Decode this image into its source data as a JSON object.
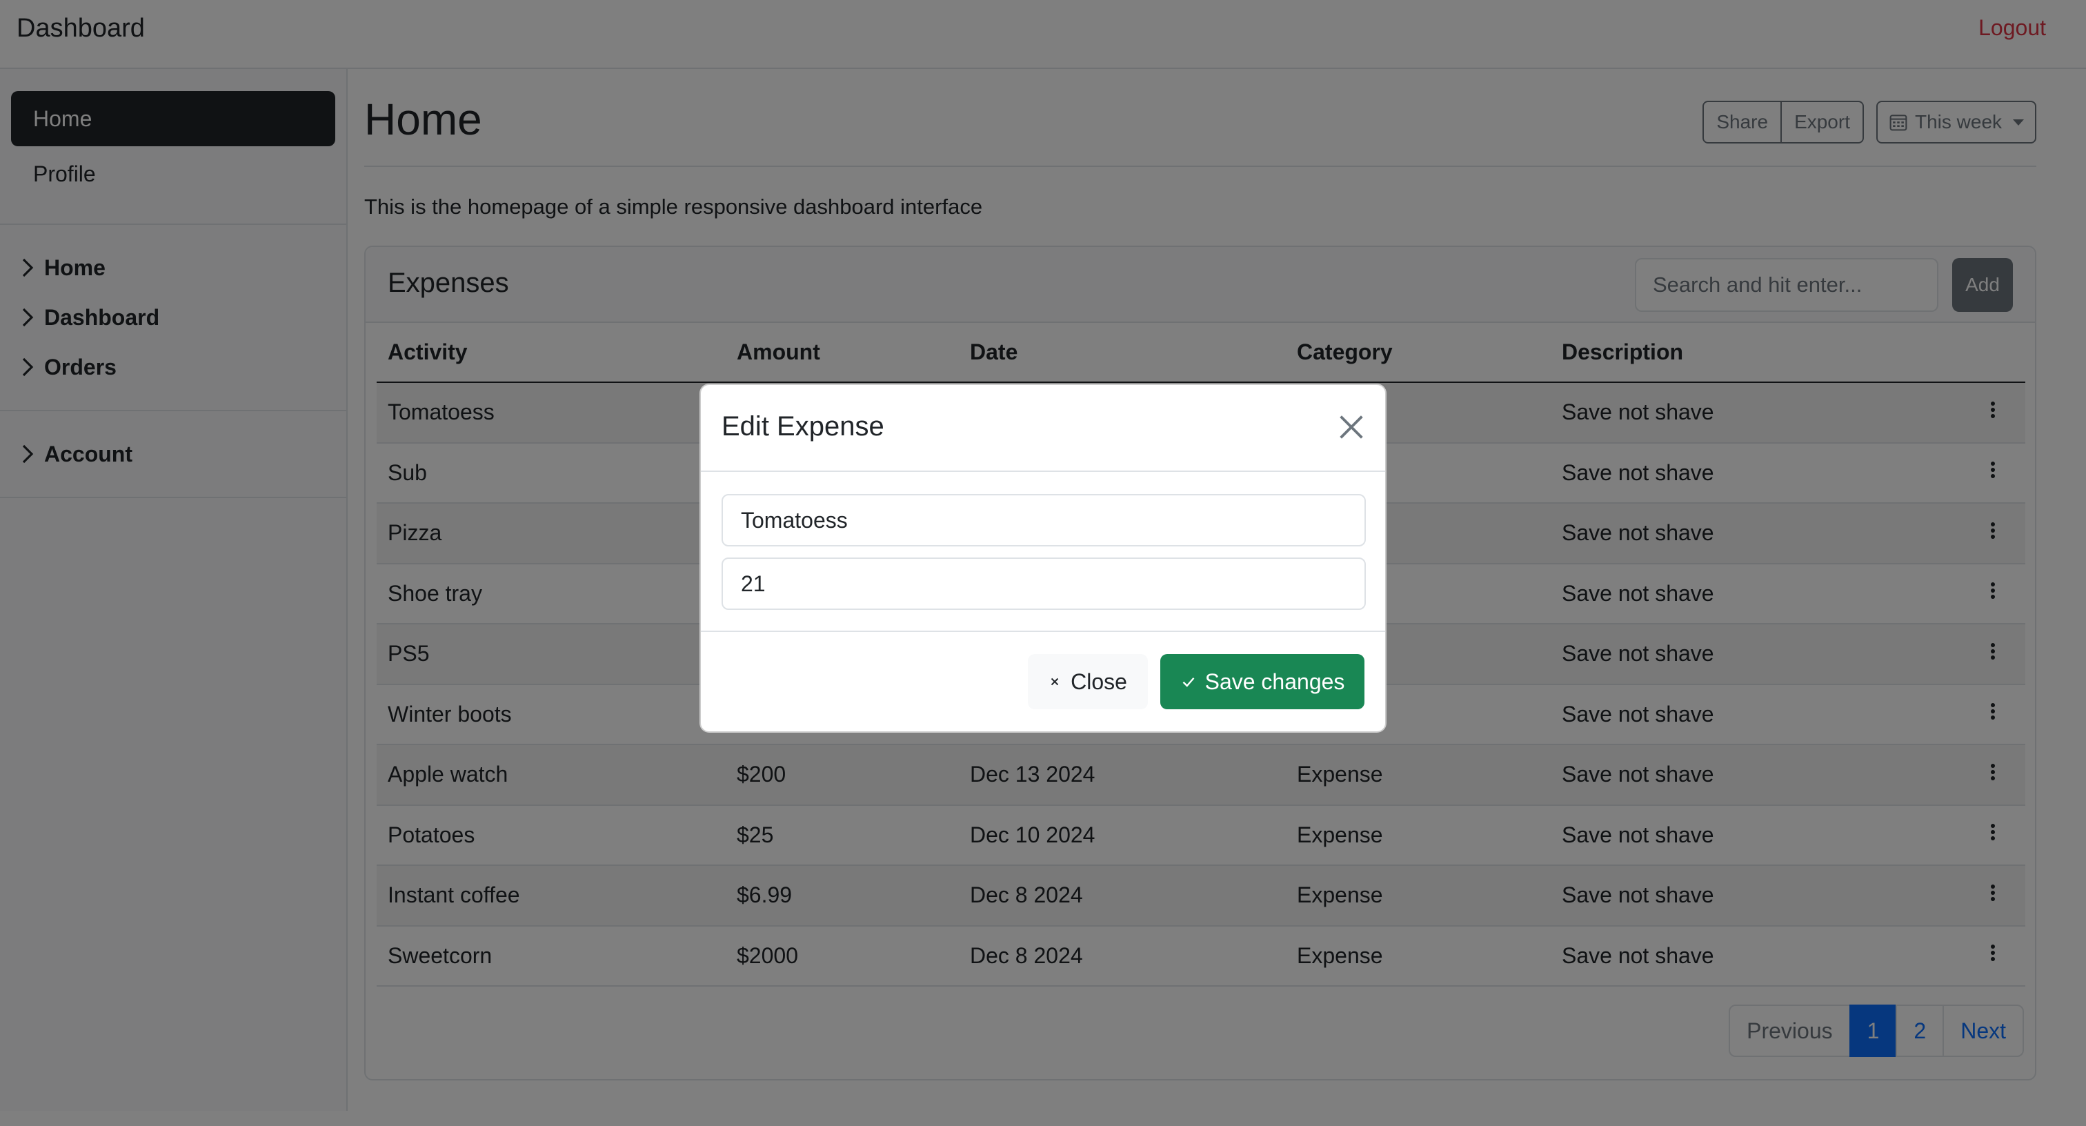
{
  "topbar": {
    "brand": "Dashboard",
    "logout": "Logout"
  },
  "sidebar": {
    "nav": [
      {
        "label": "Home",
        "active": true
      },
      {
        "label": "Profile",
        "active": false
      }
    ],
    "tree": [
      "Home",
      "Dashboard",
      "Orders"
    ],
    "account": "Account"
  },
  "page": {
    "title": "Home",
    "share": "Share",
    "export": "Export",
    "week": "This week",
    "intro": "This is the homepage of a simple responsive dashboard interface"
  },
  "card": {
    "title": "Expenses",
    "search_placeholder": "Search and hit enter...",
    "add": "Add",
    "columns": [
      "Activity",
      "Amount",
      "Date",
      "Category",
      "Description"
    ],
    "rows": [
      {
        "activity": "Tomatoess",
        "amount": "",
        "date": "",
        "category": "",
        "description": "Save not shave"
      },
      {
        "activity": "Sub",
        "amount": "",
        "date": "",
        "category": "",
        "description": "Save not shave"
      },
      {
        "activity": "Pizza",
        "amount": "",
        "date": "",
        "category": "",
        "description": "Save not shave"
      },
      {
        "activity": "Shoe tray",
        "amount": "",
        "date": "",
        "category": "",
        "description": "Save not shave"
      },
      {
        "activity": "PS5",
        "amount": "",
        "date": "",
        "category": "",
        "description": "Save not shave"
      },
      {
        "activity": "Winter boots",
        "amount": "",
        "date": "",
        "category": "",
        "description": "Save not shave"
      },
      {
        "activity": "Apple watch",
        "amount": "$200",
        "date": "Dec 13 2024",
        "category": "Expense",
        "description": "Save not shave"
      },
      {
        "activity": "Potatoes",
        "amount": "$25",
        "date": "Dec 10 2024",
        "category": "Expense",
        "description": "Save not shave"
      },
      {
        "activity": "Instant coffee",
        "amount": "$6.99",
        "date": "Dec 8 2024",
        "category": "Expense",
        "description": "Save not shave"
      },
      {
        "activity": "Sweetcorn",
        "amount": "$2000",
        "date": "Dec 8 2024",
        "category": "Expense",
        "description": "Save not shave"
      }
    ],
    "pagination": {
      "previous": "Previous",
      "pages": [
        "1",
        "2"
      ],
      "next": "Next"
    }
  },
  "modal": {
    "title": "Edit Expense",
    "activity_value": "Tomatoess",
    "amount_value": "21",
    "close": "Close",
    "save": "Save changes"
  },
  "colors": {
    "primary": "#0d6efd",
    "success": "#198754",
    "danger": "#dc3545",
    "secondary": "#6c757d",
    "dark": "#212529"
  },
  "icons": {
    "close": "close-icon",
    "check": "check-icon",
    "calendar": "calendar-icon",
    "chevron": "chevron-right-icon",
    "kebab": "kebab-menu-icon"
  }
}
